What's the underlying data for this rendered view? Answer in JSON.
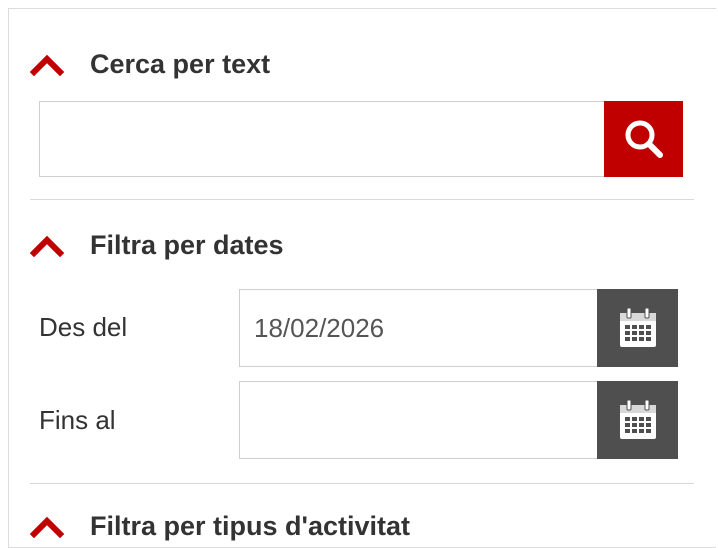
{
  "sections": {
    "text_search": {
      "title": "Cerca per text",
      "input_value": "",
      "button_icon": "search-icon",
      "accent_color": "#c00000"
    },
    "date_filter": {
      "title": "Filtra per dates",
      "from_label": "Des del",
      "from_value": "18/02/2026",
      "to_label": "Fins al",
      "to_value": "",
      "calendar_icon": "calendar-icon"
    },
    "activity_type_filter": {
      "title": "Filtra per tipus d'activitat"
    }
  },
  "colors": {
    "accent": "#c00000",
    "calendar_button": "#4f4f4f",
    "text": "#333333"
  }
}
